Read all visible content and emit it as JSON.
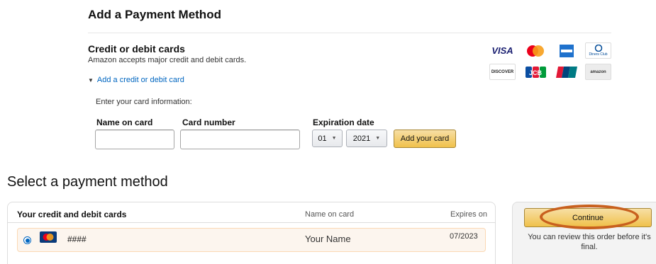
{
  "add_payment": {
    "title": "Add a Payment Method",
    "cards_heading": "Credit or debit cards",
    "cards_subtitle": "Amazon accepts major credit and debit cards.",
    "add_card_link": "Add a credit or debit card",
    "enter_info": "Enter your card information:",
    "name_label": "Name on card",
    "number_label": "Card number",
    "expiration_label": "Expiration date",
    "month_value": "01",
    "year_value": "2021",
    "add_button": "Add your card",
    "logos": {
      "visa": "VISA",
      "discover": "DISCOVER",
      "jcb": "JCB",
      "diners": "Diners Club",
      "amazon": "amazon"
    }
  },
  "select_payment": {
    "title": "Select a payment method",
    "header": "Your credit and debit cards",
    "col_name": "Name on card",
    "col_expires": "Expires on",
    "card_number": "####",
    "card_name": "Your Name",
    "card_expiry": "07/2023"
  },
  "sidebar": {
    "continue_label": "Continue",
    "review_text": "You can review this order before it's final."
  },
  "colors": {
    "link": "#0066c0",
    "button_yellow": "#f0c14b",
    "highlight_oval": "#c8601e",
    "selected_row": "#fcf5ee"
  }
}
